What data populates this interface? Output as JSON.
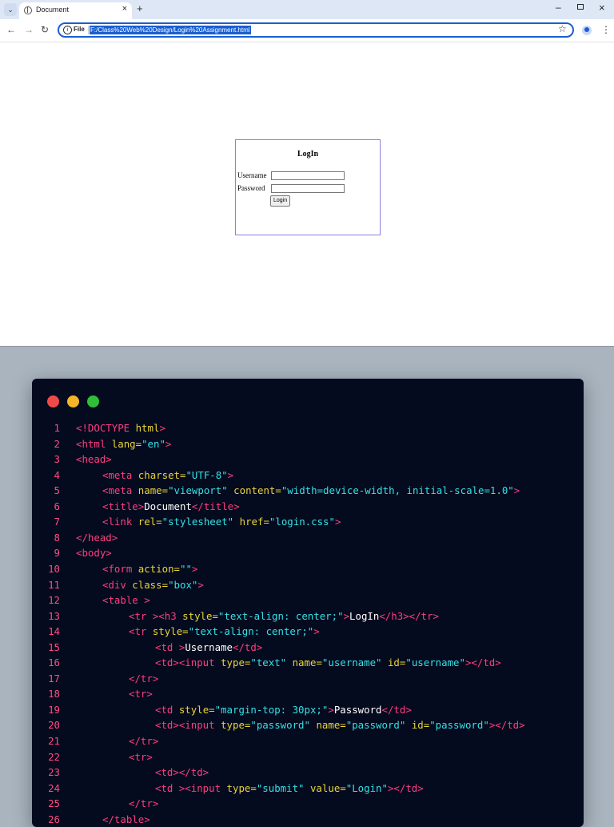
{
  "browser": {
    "tab_title": "Document",
    "url_scheme": "File",
    "url": "F:/Class%20Web%20Design/Login%20Assignment.html"
  },
  "icons": {
    "tab_search": "chevron-down-icon",
    "favicon": "globe-icon",
    "tab_close": "close-icon",
    "new_tab": "plus-icon",
    "back": "arrow-left-icon",
    "forward": "arrow-right-icon",
    "reload": "reload-icon",
    "site_info": "info-icon",
    "bookmark": "star-icon",
    "profile": "profile-icon",
    "menu": "kebab-icon"
  },
  "page": {
    "heading": "LogIn",
    "username_label": "Username",
    "password_label": "Password",
    "login_button": "Login"
  },
  "code_window": {
    "colors": {
      "tag": "#ff3d81",
      "attr": "#e8d43a",
      "string": "#35e0e6",
      "text": "#ffffff",
      "background": "#050b1e"
    },
    "lines": [
      {
        "n": "1",
        "indent": 0,
        "segs": [
          [
            "tag",
            "<!DOCTYPE"
          ],
          [
            "attr",
            " html"
          ],
          [
            "tag",
            ">"
          ]
        ]
      },
      {
        "n": "2",
        "indent": 0,
        "segs": [
          [
            "tag",
            "<html"
          ],
          [
            "attr",
            " lang="
          ],
          [
            "str",
            "\"en\""
          ],
          [
            "tag",
            ">"
          ]
        ]
      },
      {
        "n": "3",
        "indent": 0,
        "segs": [
          [
            "tag",
            "<head>"
          ]
        ]
      },
      {
        "n": "4",
        "indent": 1,
        "segs": [
          [
            "tag",
            "<meta"
          ],
          [
            "attr",
            " charset="
          ],
          [
            "str",
            "\"UTF-8\""
          ],
          [
            "tag",
            ">"
          ]
        ]
      },
      {
        "n": "5",
        "indent": 1,
        "segs": [
          [
            "tag",
            "<meta"
          ],
          [
            "attr",
            " name="
          ],
          [
            "str",
            "\"viewport\""
          ],
          [
            "attr",
            " content="
          ],
          [
            "str",
            "\"width=device-width, initial-scale=1.0\""
          ],
          [
            "tag",
            ">"
          ]
        ]
      },
      {
        "n": "6",
        "indent": 1,
        "segs": [
          [
            "tag",
            "<title>"
          ],
          [
            "plain",
            "Document"
          ],
          [
            "tag",
            "</title>"
          ]
        ]
      },
      {
        "n": "7",
        "indent": 1,
        "segs": [
          [
            "tag",
            "<link"
          ],
          [
            "attr",
            " rel="
          ],
          [
            "str",
            "\"stylesheet\""
          ],
          [
            "attr",
            " href="
          ],
          [
            "str",
            "\"login.css\""
          ],
          [
            "tag",
            ">"
          ]
        ]
      },
      {
        "n": "8",
        "indent": 0,
        "segs": [
          [
            "tag",
            "</head>"
          ]
        ]
      },
      {
        "n": "9",
        "indent": 0,
        "segs": [
          [
            "tag",
            "<body>"
          ]
        ]
      },
      {
        "n": "10",
        "indent": 1,
        "segs": [
          [
            "tag",
            "<form"
          ],
          [
            "attr",
            " action="
          ],
          [
            "str",
            "\"\""
          ],
          [
            "tag",
            ">"
          ]
        ]
      },
      {
        "n": "11",
        "indent": 1,
        "segs": [
          [
            "tag",
            "<div"
          ],
          [
            "attr",
            " class="
          ],
          [
            "str",
            "\"box\""
          ],
          [
            "tag",
            ">"
          ]
        ]
      },
      {
        "n": "12",
        "indent": 1,
        "segs": [
          [
            "tag",
            "<table >"
          ]
        ]
      },
      {
        "n": "13",
        "indent": 2,
        "segs": [
          [
            "tag",
            "<tr ><h3"
          ],
          [
            "attr",
            " style="
          ],
          [
            "str",
            "\"text-align: center;\""
          ],
          [
            "tag",
            ">"
          ],
          [
            "plain",
            "LogIn"
          ],
          [
            "tag",
            "</h3></tr>"
          ]
        ]
      },
      {
        "n": "14",
        "indent": 2,
        "segs": [
          [
            "tag",
            "<tr"
          ],
          [
            "attr",
            " style="
          ],
          [
            "str",
            "\"text-align: center;\""
          ],
          [
            "tag",
            ">"
          ]
        ]
      },
      {
        "n": "15",
        "indent": 3,
        "segs": [
          [
            "tag",
            "<td >"
          ],
          [
            "plain",
            "Username"
          ],
          [
            "tag",
            "</td>"
          ]
        ]
      },
      {
        "n": "16",
        "indent": 3,
        "segs": [
          [
            "tag",
            "<td><input"
          ],
          [
            "attr",
            " type="
          ],
          [
            "str",
            "\"text\""
          ],
          [
            "attr",
            " name="
          ],
          [
            "str",
            "\"username\""
          ],
          [
            "attr",
            " id="
          ],
          [
            "str",
            "\"username\""
          ],
          [
            "tag",
            "></td>"
          ]
        ]
      },
      {
        "n": "17",
        "indent": 2,
        "segs": [
          [
            "tag",
            "</tr>"
          ]
        ]
      },
      {
        "n": "18",
        "indent": 2,
        "segs": [
          [
            "tag",
            "<tr>"
          ]
        ]
      },
      {
        "n": "19",
        "indent": 3,
        "segs": [
          [
            "tag",
            "<td"
          ],
          [
            "attr",
            " style="
          ],
          [
            "str",
            "\"margin-top: 30px;\""
          ],
          [
            "tag",
            ">"
          ],
          [
            "plain",
            "Password"
          ],
          [
            "tag",
            "</td>"
          ]
        ]
      },
      {
        "n": "20",
        "indent": 3,
        "segs": [
          [
            "tag",
            "<td><input"
          ],
          [
            "attr",
            " type="
          ],
          [
            "str",
            "\"password\""
          ],
          [
            "attr",
            " name="
          ],
          [
            "str",
            "\"password\""
          ],
          [
            "attr",
            " id="
          ],
          [
            "str",
            "\"password\""
          ],
          [
            "tag",
            "></td>"
          ]
        ]
      },
      {
        "n": "21",
        "indent": 2,
        "segs": [
          [
            "tag",
            "</tr>"
          ]
        ]
      },
      {
        "n": "22",
        "indent": 2,
        "segs": [
          [
            "tag",
            "<tr>"
          ]
        ]
      },
      {
        "n": "23",
        "indent": 3,
        "segs": [
          [
            "tag",
            "<td></td>"
          ]
        ]
      },
      {
        "n": "24",
        "indent": 3,
        "segs": [
          [
            "tag",
            "<td ><input"
          ],
          [
            "attr",
            " type="
          ],
          [
            "str",
            "\"submit\""
          ],
          [
            "attr",
            " value="
          ],
          [
            "str",
            "\"Login\""
          ],
          [
            "tag",
            "></td>"
          ]
        ]
      },
      {
        "n": "25",
        "indent": 2,
        "segs": [
          [
            "tag",
            "</tr>"
          ]
        ]
      },
      {
        "n": "26",
        "indent": 1,
        "segs": [
          [
            "tag",
            "</table>"
          ]
        ]
      }
    ]
  }
}
